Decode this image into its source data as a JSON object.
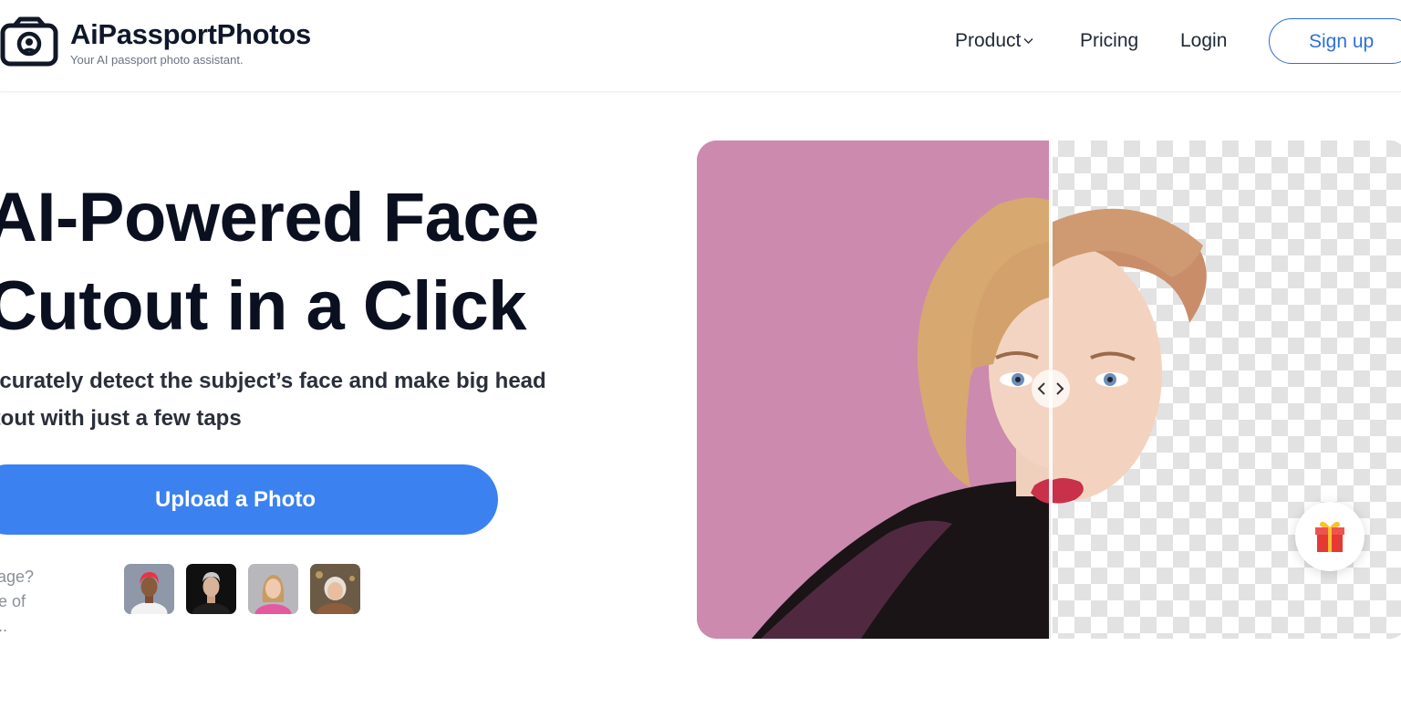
{
  "header": {
    "brand": "AiPassportPhotos",
    "tagline": "Your AI passport photo assistant.",
    "nav": {
      "product": "Product",
      "pricing": "Pricing",
      "login": "Login",
      "signup": "Sign up"
    }
  },
  "hero": {
    "title_line1": "AI-Powered Face",
    "title_line2": "Cutout in a Click",
    "subtitle_line1": "ccurately detect the subject’s face and make big head",
    "subtitle_line2": "ıtout with just a few taps",
    "upload_button": "Upload a Photo",
    "sample_caption_line1": "image?",
    "sample_caption_line2": "one of",
    "sample_caption_line3": "m..."
  },
  "samples": [
    "sample-photo-red-hair",
    "sample-photo-gray-hair",
    "sample-photo-blonde-woman",
    "sample-photo-elderly-woman"
  ],
  "colors": {
    "accent": "#3b82f0",
    "signup_border": "#2f6fd6",
    "compare_background": "#cc8aaf"
  },
  "icons": {
    "logo": "camera-icon",
    "compare_handle": "chevron-left-right-icon",
    "gift": "gift-icon"
  }
}
